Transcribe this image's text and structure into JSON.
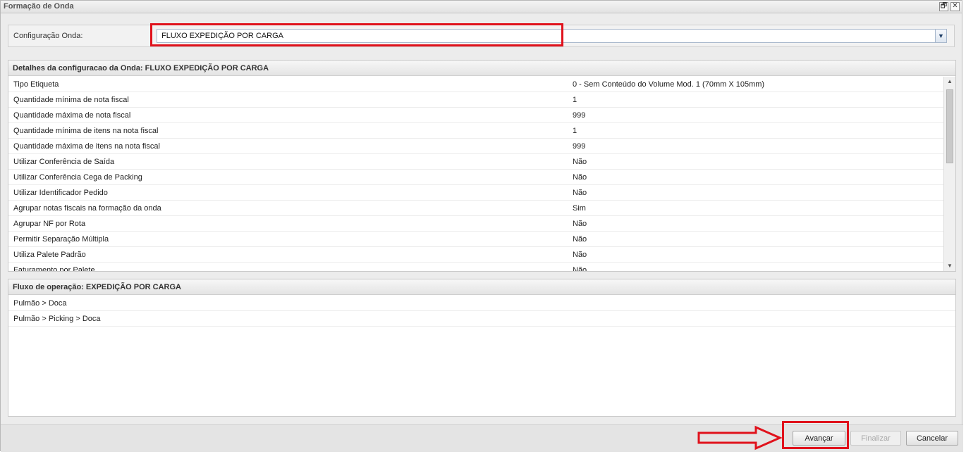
{
  "window": {
    "title": "Formação de Onda",
    "restore_glyph": "🗗",
    "close_glyph": "✕"
  },
  "config": {
    "label": "Configuração Onda:",
    "selected_value": "FLUXO EXPEDIÇÃO POR CARGA",
    "trigger_glyph": "▼"
  },
  "details": {
    "header": "Detalhes da configuracao da Onda: FLUXO EXPEDIÇÃO POR CARGA",
    "rows": [
      {
        "key": "Tipo Etiqueta",
        "value": "0 - Sem Conteúdo do Volume Mod. 1 (70mm X 105mm)"
      },
      {
        "key": "Quantidade mínima de nota fiscal",
        "value": "1"
      },
      {
        "key": "Quantidade máxima de nota fiscal",
        "value": "999"
      },
      {
        "key": "Quantidade mínima de itens na nota fiscal",
        "value": "1"
      },
      {
        "key": "Quantidade máxima de itens na nota fiscal",
        "value": "999"
      },
      {
        "key": "Utilizar Conferência de Saída",
        "value": "Não"
      },
      {
        "key": "Utilizar Conferência Cega de Packing",
        "value": "Não"
      },
      {
        "key": "Utilizar Identificador Pedido",
        "value": "Não"
      },
      {
        "key": "Agrupar notas fiscais na formação da onda",
        "value": "Sim"
      },
      {
        "key": "Agrupar NF por Rota",
        "value": "Não"
      },
      {
        "key": "Permitir Separação Múltipla",
        "value": "Não"
      },
      {
        "key": "Utiliza Palete Padrão",
        "value": "Não"
      },
      {
        "key": "Faturamento por Palete",
        "value": "Não"
      }
    ],
    "scroll_up_glyph": "▲",
    "scroll_down_glyph": "▼"
  },
  "fluxo": {
    "header": "Fluxo de operação: EXPEDIÇÃO POR CARGA",
    "rows": [
      "Pulmão > Doca",
      "Pulmão > Picking > Doca"
    ]
  },
  "footer": {
    "avancar_label": "Avançar",
    "finalizar_label": "Finalizar",
    "cancelar_label": "Cancelar"
  },
  "colors": {
    "annotation_red": "#e0121c",
    "accent_border": "#a8b8cc"
  }
}
